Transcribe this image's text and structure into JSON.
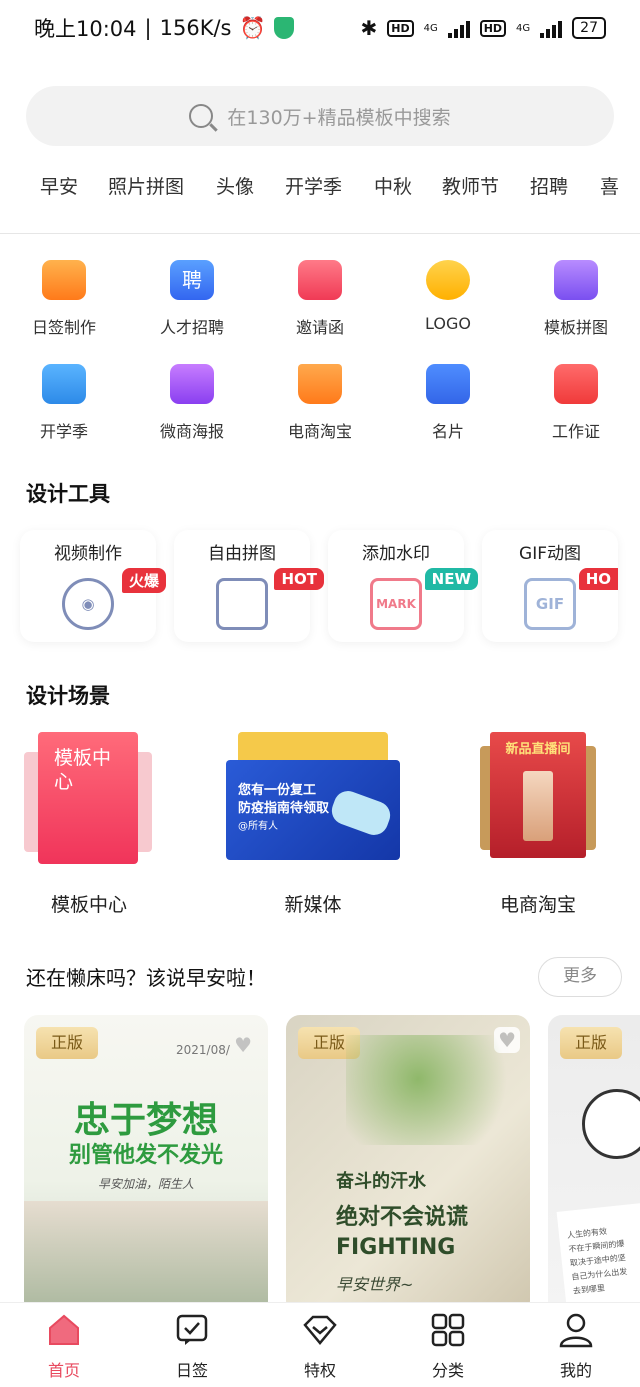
{
  "status_bar": {
    "time": "晚上10:04",
    "speed": "156K/s",
    "hd": "HD",
    "net": "4G",
    "battery": "27"
  },
  "search": {
    "placeholder": "在130万+精品模板中搜索"
  },
  "tags": [
    "早安",
    "照片拼图",
    "头像",
    "开学季",
    "中秋",
    "教师节",
    "招聘",
    "喜"
  ],
  "categories": [
    {
      "label": "日签制作",
      "icon": "calendar-check-icon"
    },
    {
      "label": "人才招聘",
      "icon": "recruit-icon"
    },
    {
      "label": "邀请函",
      "icon": "envelope-icon"
    },
    {
      "label": "LOGO",
      "icon": "palette-icon"
    },
    {
      "label": "模板拼图",
      "icon": "grid-icon"
    },
    {
      "label": "开学季",
      "icon": "book-icon"
    },
    {
      "label": "微商海报",
      "icon": "chart-icon"
    },
    {
      "label": "电商淘宝",
      "icon": "basket-icon"
    },
    {
      "label": "名片",
      "icon": "card-icon"
    },
    {
      "label": "工作证",
      "icon": "badge-icon"
    }
  ],
  "design_tools": {
    "title": "设计工具",
    "items": [
      {
        "label": "视频制作",
        "badge": "火爆",
        "icon": "film-reel-icon"
      },
      {
        "label": "自由拼图",
        "badge": "HOT",
        "icon": "collage-icon"
      },
      {
        "label": "添加水印",
        "badge": "NEW",
        "icon": "watermark-icon",
        "icon_text": "MARK"
      },
      {
        "label": "GIF动图",
        "badge": "HO",
        "icon": "gif-icon",
        "icon_text": "GIF"
      }
    ]
  },
  "design_scenes": {
    "title": "设计场景",
    "items": [
      {
        "label": "模板中心",
        "art_text": "模板中心"
      },
      {
        "label": "新媒体",
        "art_text": [
          "您有一份复工",
          "防疫指南待领取",
          "@所有人"
        ]
      },
      {
        "label": "电商淘宝",
        "art_text": "新品直播间"
      }
    ]
  },
  "morning": {
    "title": "还在懒床吗？该说早安啦！",
    "more": "更多",
    "cards": [
      {
        "badge": "正版",
        "date": "2021/08/",
        "text": [
          "忠于梦想",
          "别管他发不发光",
          "早安加油，陌生人"
        ]
      },
      {
        "badge": "正版",
        "text": [
          "奋斗的汗水",
          "绝对不会说谎",
          "FIGHTING",
          "早安世界~"
        ]
      },
      {
        "badge": "正版",
        "text": [
          "人生的有效",
          "不在于瞬间的爆",
          "取决于途中的坚",
          "自己为什么出发",
          "去到哪里"
        ]
      }
    ]
  },
  "tabbar": [
    {
      "label": "首页",
      "icon": "home-icon",
      "active": true
    },
    {
      "label": "日签",
      "icon": "daily-check-icon",
      "active": false
    },
    {
      "label": "特权",
      "icon": "diamond-icon",
      "active": false
    },
    {
      "label": "分类",
      "icon": "category-grid-icon",
      "active": false
    },
    {
      "label": "我的",
      "icon": "profile-icon",
      "active": false
    }
  ],
  "colors": {
    "accent": "#e84a5f",
    "badge_red": "#e8323c",
    "badge_teal": "#20b9a5",
    "gold": "#e9c986"
  }
}
